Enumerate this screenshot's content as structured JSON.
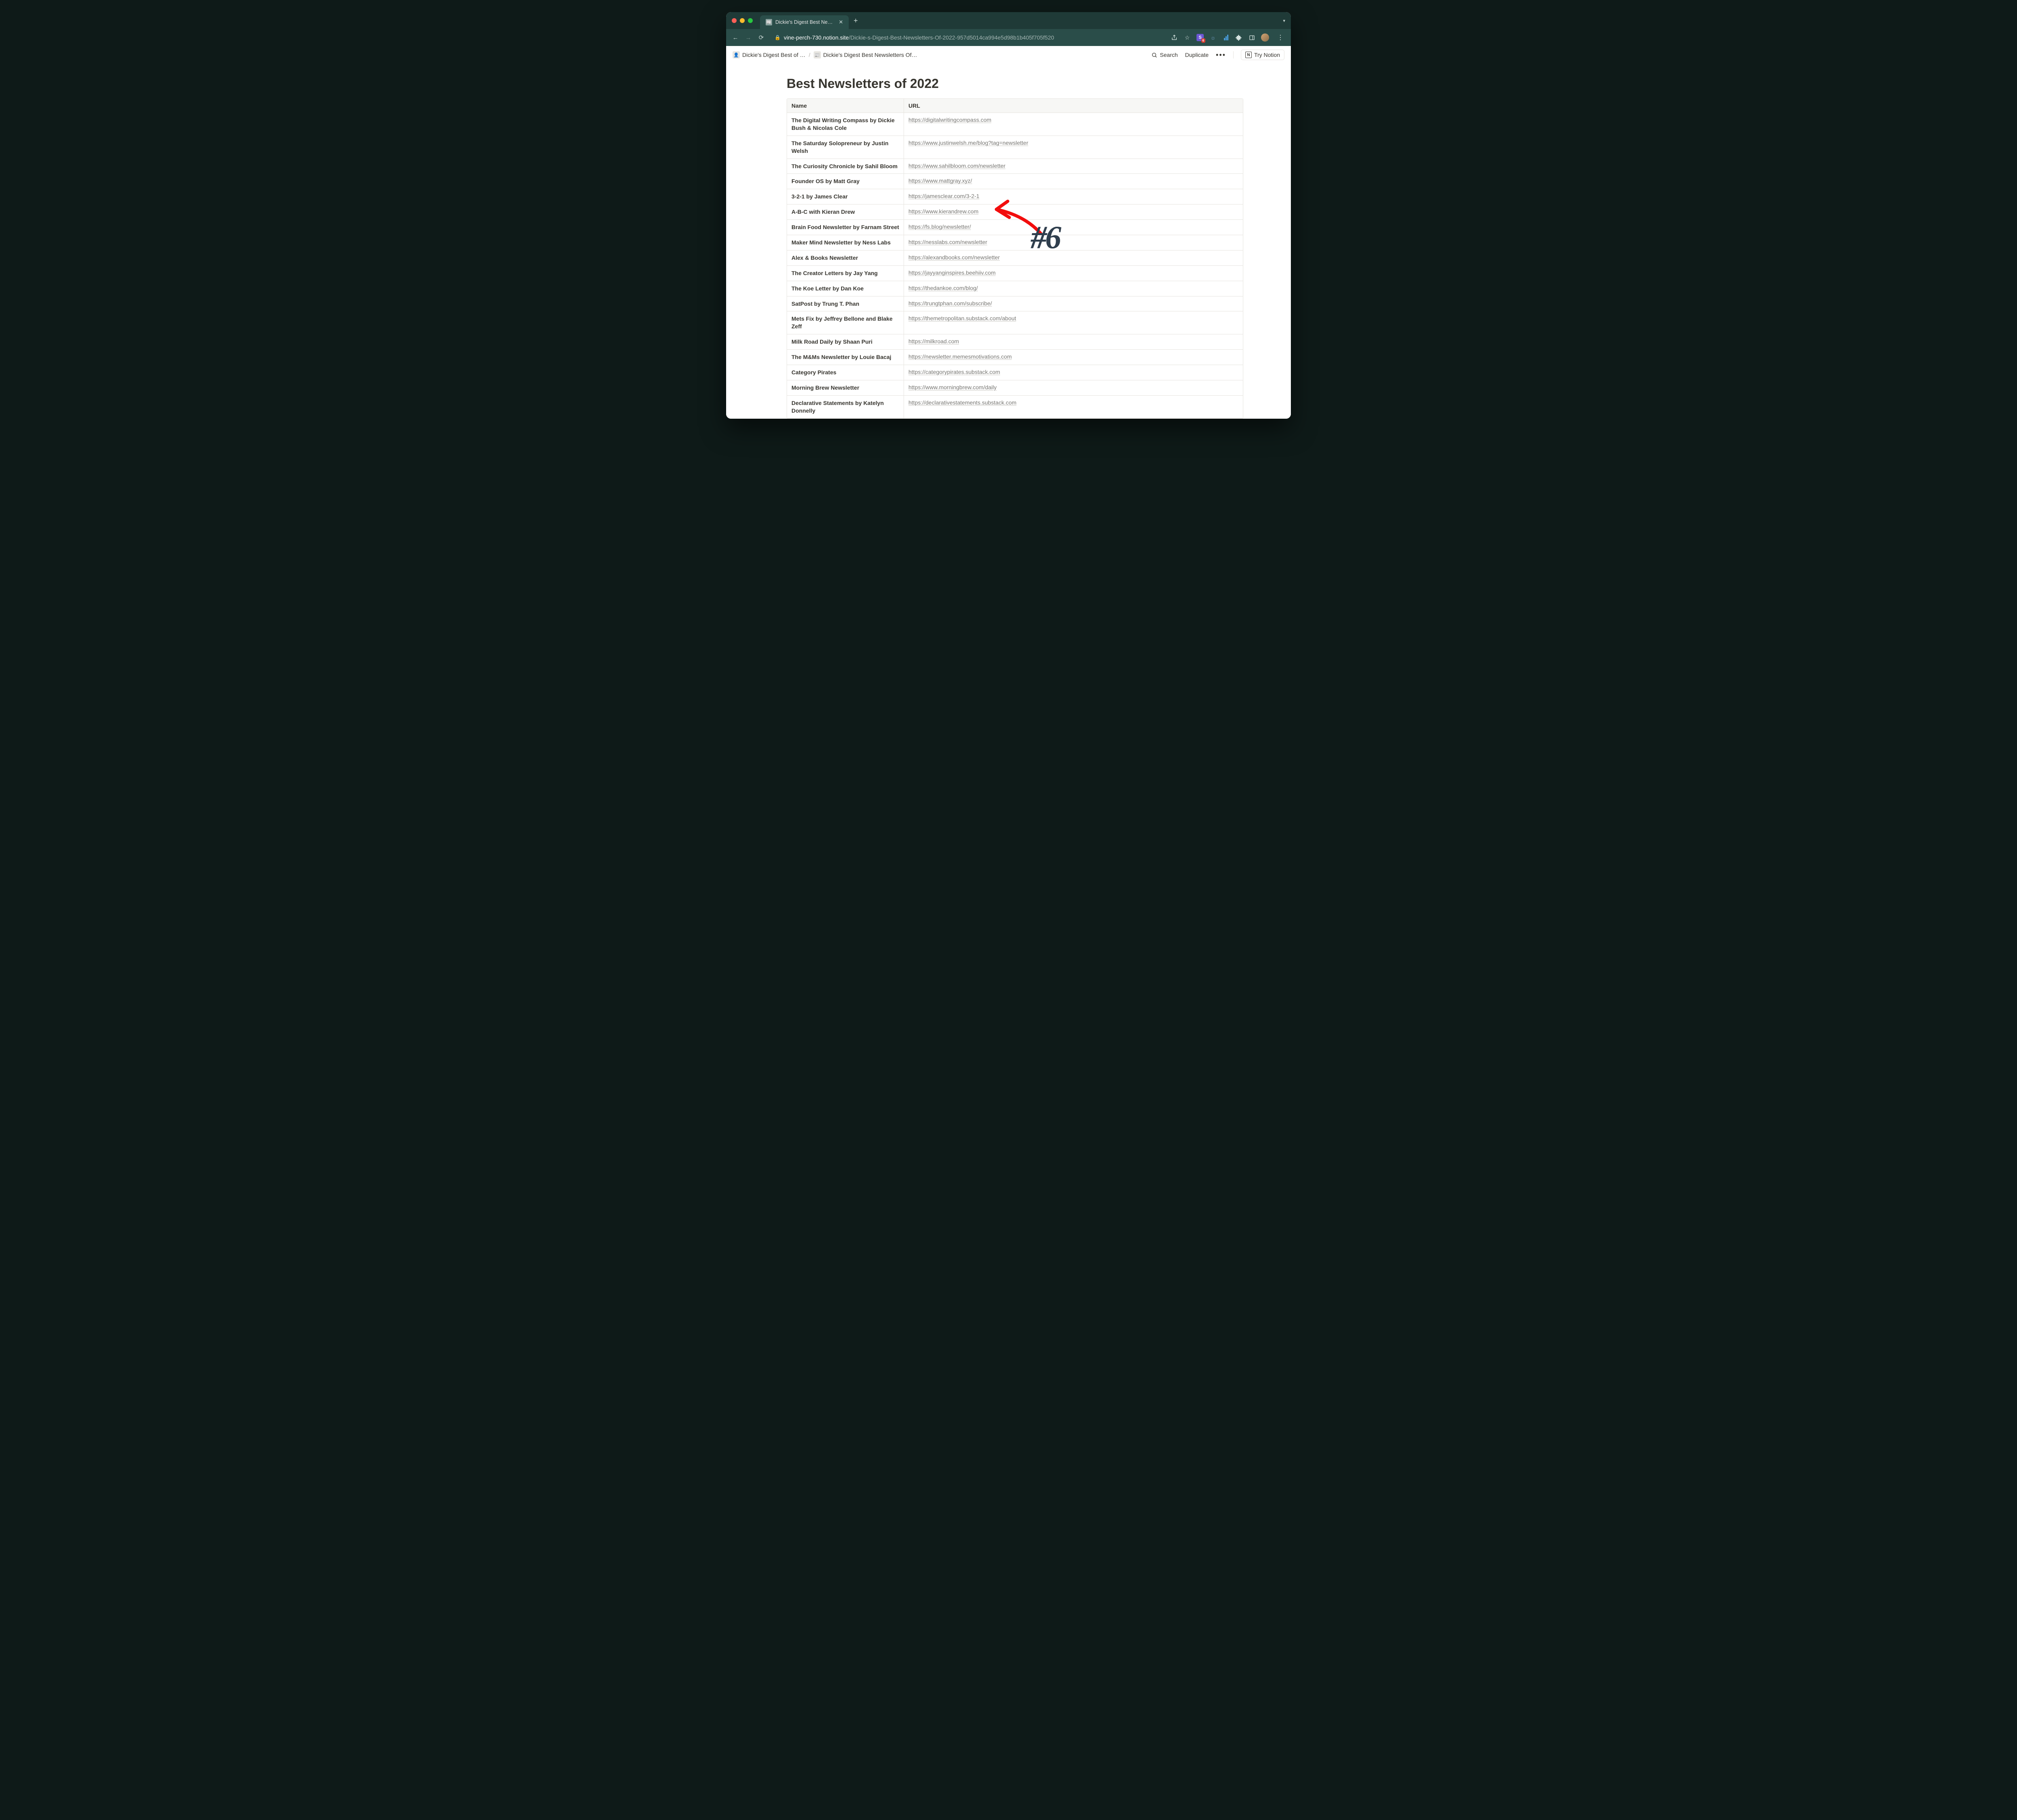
{
  "browser": {
    "tab_title": "Dickie's Digest Best Newslette",
    "url_host": "vine-perch-730.notion.site",
    "url_path": "/Dickie-s-Digest-Best-Newsletters-Of-2022-957d5014ca994e5d98b1b405f705f520",
    "ext_s_label": "S",
    "ext_badge_count": "6"
  },
  "topbar": {
    "crumb1": "Dickie's Digest Best of …",
    "crumb2": "Dickie's Digest Best Newsletters Of…",
    "search_label": "Search",
    "duplicate_label": "Duplicate",
    "try_notion_label": "Try Notion"
  },
  "page": {
    "title": "Best Newsletters of 2022"
  },
  "table": {
    "header_name": "Name",
    "header_url": "URL",
    "rows": [
      {
        "name": "The Digital Writing Compass by Dickie Bush & Nicolas Cole",
        "url": "https://digitalwritingcompass.com"
      },
      {
        "name": "The Saturday Solopreneur by Justin Welsh",
        "url": "https://www.justinwelsh.me/blog?tag=newsletter"
      },
      {
        "name": "The Curiosity Chronicle by Sahil Bloom",
        "url": "https://www.sahilbloom.com/newsletter"
      },
      {
        "name": "Founder OS by Matt Gray",
        "url": "https://www.mattgray.xyz/"
      },
      {
        "name": "3-2-1 by James Clear",
        "url": "https://jamesclear.com/3-2-1"
      },
      {
        "name": "A-B-C with Kieran Drew",
        "url": "https://www.kierandrew.com"
      },
      {
        "name": "Brain Food Newsletter by  Farnam Street",
        "url": "https://fs.blog/newsletter/"
      },
      {
        "name": "Maker Mind Newsletter by Ness Labs",
        "url": "https://nesslabs.com/newsletter"
      },
      {
        "name": "Alex & Books Newsletter",
        "url": "https://alexandbooks.com/newsletter"
      },
      {
        "name": "The Creator Letters by Jay Yang",
        "url": "https://jayyanginspires.beehiiv.com"
      },
      {
        "name": "The Koe Letter by Dan Koe",
        "url": "https://thedankoe.com/blog/"
      },
      {
        "name": "SatPost by Trung T. Phan",
        "url": "https://trungtphan.com/subscribe/"
      },
      {
        "name": "Mets Fix by Jeffrey Bellone and Blake Zeff",
        "url": "https://themetropolitan.substack.com/about"
      },
      {
        "name": "Milk Road Daily by Shaan Puri",
        "url": "https://milkroad.com"
      },
      {
        "name": "The M&Ms Newsletter by Louie Bacaj",
        "url": "https://newsletter.memesmotivations.com"
      },
      {
        "name": "Category Pirates",
        "url": "https://categorypirates.substack.com"
      },
      {
        "name": "Morning Brew Newsletter",
        "url": "https://www.morningbrew.com/daily"
      },
      {
        "name": "Declarative Statements by Katelyn Donnelly",
        "url": "https://declarativestatements.substack.com"
      }
    ]
  },
  "annotation": {
    "label": "#6"
  }
}
